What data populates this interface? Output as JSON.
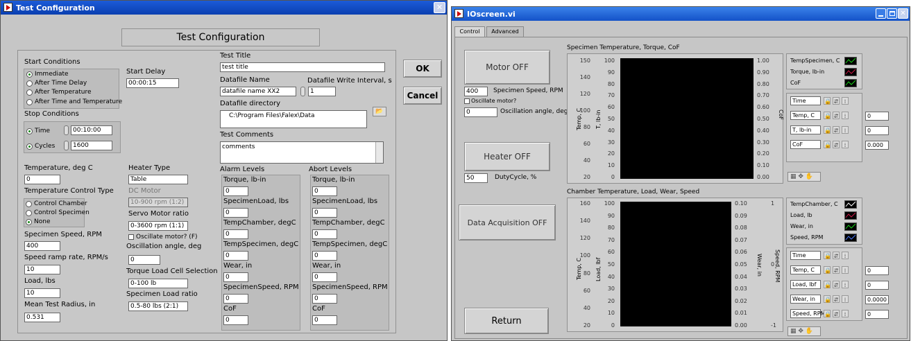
{
  "left": {
    "title": "Test Configuration",
    "header": "Test Configuration",
    "ok": "OK",
    "cancel": "Cancel",
    "start_conditions": "Start Conditions",
    "start_options": [
      "Immediate",
      "After Time Delay",
      "After Temperature",
      "After Time and Temperature"
    ],
    "start_delay_label": "Start Delay",
    "start_delay": "00:00:15",
    "stop_conditions": "Stop Conditions",
    "stop_time_label": "Time",
    "stop_time": "00:10:00",
    "stop_cycles_label": "Cycles",
    "stop_cycles": "1600",
    "test_title_label": "Test Title",
    "test_title": "test title",
    "datafile_name_label": "Datafile Name",
    "datafile_name": "datafile name XX2",
    "write_interval_label": "Datafile Write Interval, s",
    "write_interval": "1",
    "datafile_dir_label": "Datafile directory",
    "datafile_dir": "C:\\Program Files\\Falex\\Data",
    "comments_label": "Test Comments",
    "comments": "comments",
    "temperature_label": "Temperature, deg C",
    "temperature": "0",
    "temp_control_label": "Temperature Control Type",
    "temp_control_options": [
      "Control Chamber",
      "Control Specimen",
      "None"
    ],
    "spec_speed_label": "Specimen Speed, RPM",
    "spec_speed": "400",
    "ramp_label": "Speed ramp rate, RPM/s",
    "ramp": "10",
    "load_label": "Load, lbs",
    "load": "10",
    "radius_label": "Mean Test Radius, in",
    "radius": "0.531",
    "heater_type_label": "Heater Type",
    "heater_type": "Table",
    "dc_motor_label": "DC Motor",
    "dc_motor": "10-900 rpm (1:2)",
    "servo_label": "Servo Motor ratio",
    "servo": "0-3600 rpm (1:1)",
    "oscillate_label": "Oscillate motor? (F)",
    "osc_angle_label": "Oscillation angle, deg",
    "osc_angle": "0",
    "torque_cell_label": "Torque Load Cell Selection",
    "torque_cell": "0-100 lb",
    "spec_load_ratio_label": "Specimen Load ratio",
    "spec_load_ratio": "0.5-80 lbs (2:1)",
    "alarm_label": "Alarm Levels",
    "abort_label": "Abort Levels",
    "level_fields": [
      {
        "label": "Torque, lb-in",
        "alarm": "0",
        "abort": "0"
      },
      {
        "label": "SpecimenLoad, lbs",
        "alarm": "0",
        "abort": "0"
      },
      {
        "label": "TempChamber, degC",
        "alarm": "0",
        "abort": "0"
      },
      {
        "label": "TempSpecimen, degC",
        "alarm": "0",
        "abort": "0"
      },
      {
        "label": "Wear, in",
        "alarm": "0",
        "abort": "0"
      },
      {
        "label": "SpecimenSpeed, RPM",
        "alarm": "0",
        "abort": "0"
      },
      {
        "label": "CoF",
        "alarm": "0",
        "abort": "0"
      }
    ]
  },
  "right": {
    "title": "IOscreen.vi",
    "tabs": [
      "Control",
      "Advanced"
    ],
    "motor_btn": "Motor OFF",
    "spec_speed": "400",
    "spec_speed_label": "Specimen Speed, RPM",
    "oscillate_label": "Oscillate motor?",
    "osc_angle": "0",
    "osc_angle_label": "Oscillation angle, deg",
    "heater_btn": "Heater OFF",
    "duty": "50",
    "duty_label": "DutyCycle, %",
    "daq_btn": "Data Acquisition OFF",
    "return_btn": "Return",
    "chart1": {
      "title": "Specimen Temperature, Torque, CoF",
      "axis_temp_label": "Temp, C",
      "axis_torque_label": "T, lb-in",
      "axis_cof_label": "CoF",
      "temp_ticks": [
        "150",
        "140",
        "120",
        "100",
        "80",
        "60",
        "40",
        "20"
      ],
      "torque_ticks": [
        "100",
        "90",
        "80",
        "70",
        "60",
        "50",
        "40",
        "30",
        "20",
        "10",
        "0"
      ],
      "cof_ticks": [
        "1.00",
        "0.90",
        "0.80",
        "0.70",
        "0.60",
        "0.50",
        "0.40",
        "0.30",
        "0.20",
        "0.10",
        "0.00"
      ],
      "legend": [
        "TempSpecimen, C",
        "Torque, lb-in",
        "CoF"
      ],
      "legend_colors": [
        "#1ad41a",
        "#d41a4a",
        "#1ad41a"
      ],
      "scales": [
        "Time",
        "Temp, C",
        "T, lb-in",
        "CoF"
      ],
      "scale_values": [
        "",
        "0",
        "0",
        "0.000"
      ]
    },
    "chart2": {
      "title": "Chamber Temperature, Load, Wear, Speed",
      "axis_temp_label": "Temp, C",
      "axis_load_label": "Load, lbf",
      "axis_wear_label": "Wear, in",
      "axis_speed_label": "Speed, RPM",
      "temp_ticks": [
        "160",
        "140",
        "120",
        "100",
        "80",
        "60",
        "40",
        "20"
      ],
      "load_ticks": [
        "100",
        "90",
        "80",
        "70",
        "60",
        "50",
        "40",
        "30",
        "20",
        "10",
        "0"
      ],
      "wear_ticks": [
        "0.10",
        "0.09",
        "0.08",
        "0.07",
        "0.06",
        "0.05",
        "0.04",
        "0.03",
        "0.02",
        "0.01",
        "0.00"
      ],
      "speed_ticks": [
        "1",
        "0",
        "-1"
      ],
      "legend": [
        "TempChamber, C",
        "Load, lb",
        "Wear, in",
        "Speed, RPM"
      ],
      "legend_colors": [
        "#ffffff",
        "#d41a4a",
        "#1ad41a",
        "#4a7aff"
      ],
      "scales": [
        "Time",
        "Temp, C",
        "Load, lbf",
        "Wear, in",
        "Speed, RPM"
      ],
      "scale_values": [
        "",
        "0",
        "0",
        "0.0000",
        "0"
      ]
    }
  }
}
